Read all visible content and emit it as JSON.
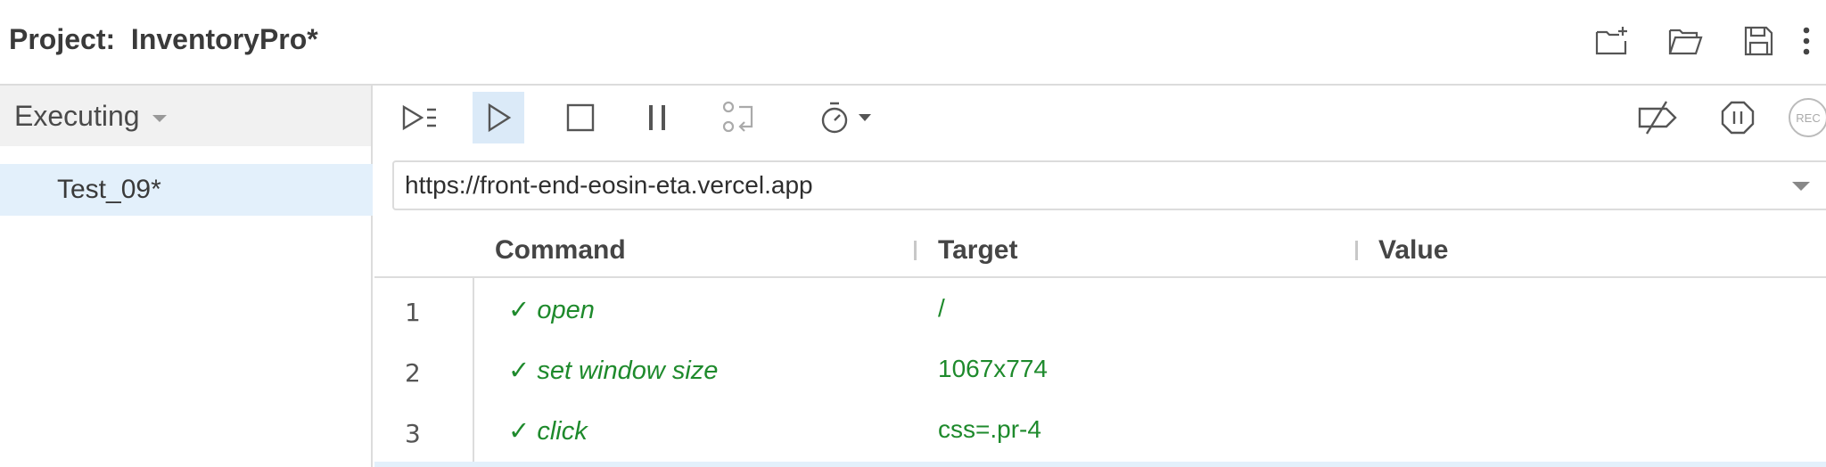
{
  "header": {
    "title": "Project:  InventoryPro*",
    "icons": [
      "new-folder-icon",
      "open-folder-icon",
      "save-icon",
      "more-vertical-icon"
    ]
  },
  "sidebar": {
    "dropdown_label": "Executing",
    "tests": [
      {
        "label": "Test_09*",
        "selected": true
      }
    ]
  },
  "toolbar": {
    "icons": [
      "run-all-tests-icon",
      "run-current-test-icon",
      "stop-icon",
      "pause-icon",
      "step-over-icon",
      "speed-timer-icon",
      "disable-breakpoints-icon",
      "pause-on-exceptions-icon",
      "record-icon"
    ],
    "record_label": "REC"
  },
  "url_bar": {
    "value": "https://front-end-eosin-eta.vercel.app"
  },
  "table": {
    "columns": [
      "Command",
      "Target",
      "Value"
    ],
    "rows": [
      {
        "num": "1",
        "check": "✓",
        "command": "open",
        "target": "/",
        "value": ""
      },
      {
        "num": "2",
        "check": "✓",
        "command": "set window size",
        "target": "1067x774",
        "value": ""
      },
      {
        "num": "3",
        "check": "✓",
        "command": "click",
        "target": "css=.pr-4",
        "value": ""
      }
    ]
  },
  "colors": {
    "pass_green": "#1e8a2c",
    "selection_blue": "#e3f0fb",
    "icon_gray": "#555555"
  }
}
